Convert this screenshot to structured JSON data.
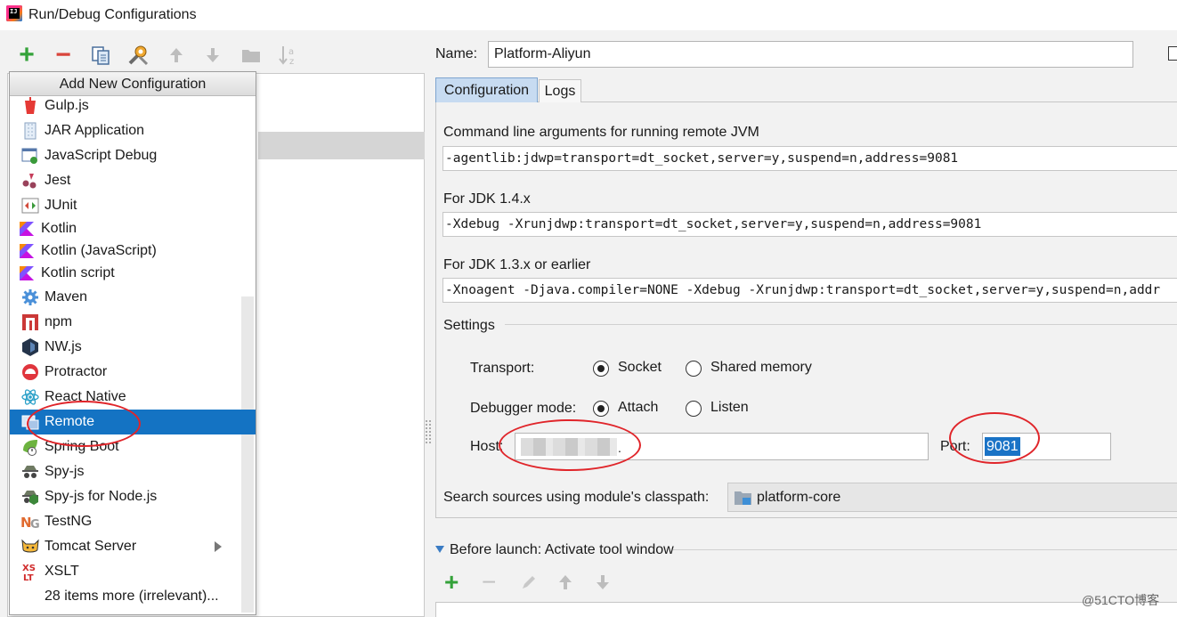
{
  "window": {
    "title": "Run/Debug Configurations"
  },
  "toolbar": {
    "buttons": [
      {
        "name": "add-icon",
        "glyph": "+",
        "color": "#34a23a"
      },
      {
        "name": "remove-icon",
        "glyph": "−",
        "color": "#d9453c"
      },
      {
        "name": "copy-icon"
      },
      {
        "name": "edit-defaults-icon"
      },
      {
        "name": "move-up-icon",
        "glyph": "🡅"
      },
      {
        "name": "move-down-icon",
        "glyph": "🡇"
      },
      {
        "name": "folder-icon"
      },
      {
        "name": "sort-icon",
        "glyph": "↓a z"
      }
    ]
  },
  "popup": {
    "header": "Add New Configuration",
    "items": [
      {
        "label": "Gulp.js",
        "icon": "gulp-icon"
      },
      {
        "label": "JAR Application",
        "icon": "jar-icon"
      },
      {
        "label": "JavaScript Debug",
        "icon": "javascript-debug-icon"
      },
      {
        "label": "Jest",
        "icon": "jest-icon"
      },
      {
        "label": "JUnit",
        "icon": "junit-icon"
      },
      {
        "label": "Kotlin",
        "icon": "kotlin-icon"
      },
      {
        "label": "Kotlin (JavaScript)",
        "icon": "kotlin-icon"
      },
      {
        "label": "Kotlin script",
        "icon": "kotlin-icon"
      },
      {
        "label": "Maven",
        "icon": "maven-icon"
      },
      {
        "label": "npm",
        "icon": "npm-icon"
      },
      {
        "label": "NW.js",
        "icon": "nwjs-icon"
      },
      {
        "label": "Protractor",
        "icon": "protractor-icon"
      },
      {
        "label": "React Native",
        "icon": "react-icon"
      },
      {
        "label": "Remote",
        "icon": "remote-icon",
        "selected": true
      },
      {
        "label": "Spring Boot",
        "icon": "spring-boot-icon"
      },
      {
        "label": "Spy-js",
        "icon": "spy-js-icon"
      },
      {
        "label": "Spy-js for Node.js",
        "icon": "spy-js-node-icon"
      },
      {
        "label": "TestNG",
        "icon": "testng-icon"
      },
      {
        "label": "Tomcat Server",
        "icon": "tomcat-icon",
        "submenu": true
      },
      {
        "label": "XSLT",
        "icon": "xslt-icon"
      },
      {
        "label": "28 items more (irrelevant)...",
        "icon": ""
      }
    ]
  },
  "form": {
    "name_label": "Name:",
    "name_value": "Platform-Aliyun",
    "tabs": [
      {
        "label": "Configuration",
        "active": true
      },
      {
        "label": "Logs",
        "active": false
      }
    ],
    "cmd_label": "Command line arguments for running remote JVM",
    "cmd_value": "-agentlib:jdwp=transport=dt_socket,server=y,suspend=n,address=9081",
    "jdk14_label": "For JDK 1.4.x",
    "jdk14_value": "-Xdebug -Xrunjdwp:transport=dt_socket,server=y,suspend=n,address=9081",
    "jdk13_label": "For JDK 1.3.x or earlier",
    "jdk13_value": "-Xnoagent -Djava.compiler=NONE -Xdebug -Xrunjdwp:transport=dt_socket,server=y,suspend=n,addr",
    "settings_label": "Settings",
    "transport_label": "Transport:",
    "transport_options": [
      "Socket",
      "Shared memory"
    ],
    "transport_selected": "Socket",
    "debugger_label": "Debugger mode:",
    "debugger_options": [
      "Attach",
      "Listen"
    ],
    "debugger_selected": "Attach",
    "host_label": "Host:",
    "port_label": "Port:",
    "port_value": "9081",
    "module_label": "Search sources using module's classpath:",
    "module_value": "platform-core",
    "before_launch_label": "Before launch: Activate tool window"
  },
  "watermark": "@51CTO博客",
  "colors": {
    "selection": "#1473c3",
    "tab_active": "#c7dbf1",
    "annotation": "#e0252a",
    "add": "#34a23a"
  }
}
